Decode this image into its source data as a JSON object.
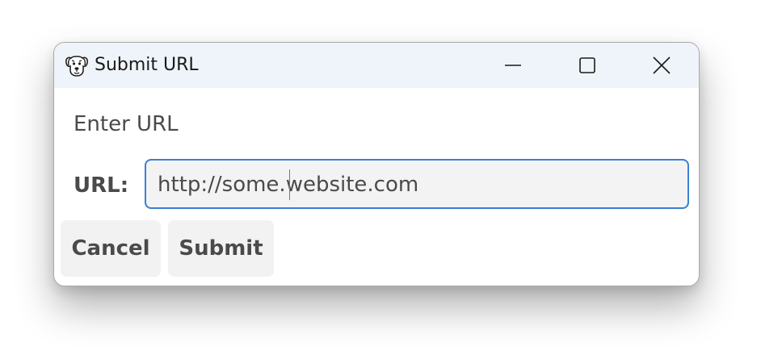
{
  "window": {
    "title": "Submit URL",
    "icon": "dog-face-icon",
    "controls": [
      "minimize-icon",
      "maximize-icon",
      "close-icon"
    ]
  },
  "form": {
    "prompt": "Enter URL",
    "url_label": "URL:",
    "url_value": "http://some.website.com"
  },
  "buttons": {
    "cancel_label": "Cancel",
    "submit_label": "Submit"
  },
  "colors": {
    "titlebar_bg": "#eff4fb",
    "input_focus_border": "#3b7fd4",
    "input_bg": "#f3f3f3",
    "button_bg": "#f2f2f2",
    "text": "#4a4a4a"
  }
}
